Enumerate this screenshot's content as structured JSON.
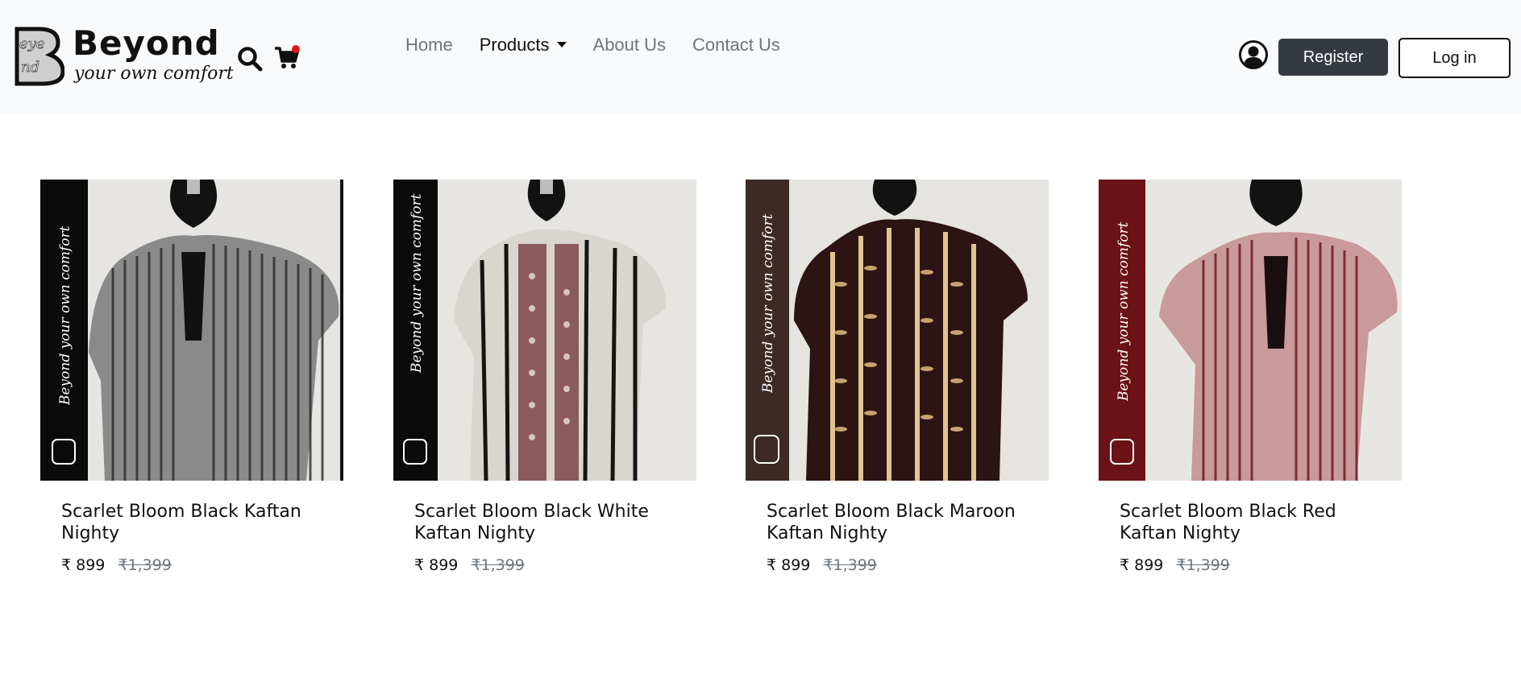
{
  "brand": {
    "mark_text": "Beyond",
    "name": "Beyond",
    "tagline": "your own comfort"
  },
  "header": {
    "search_icon": "search-icon",
    "cart_icon": "cart-icon",
    "user_icon": "user-circle-icon",
    "cart_badge_color": "#e21818",
    "nav": [
      {
        "label": "Home"
      },
      {
        "label": "Products"
      },
      {
        "label": "About Us"
      },
      {
        "label": "Contact Us"
      }
    ],
    "register_label": "Register",
    "login_label": "Log in"
  },
  "products": [
    {
      "name": "Scarlet Bloom Black Kaftan Nighty",
      "price": "₹ 899",
      "mrp": "₹1,399",
      "band_color": "#0b0b0b",
      "watermark": "Beyond your own comfort"
    },
    {
      "name": "Scarlet Bloom Black White Kaftan Nighty",
      "price": "₹ 899",
      "mrp": "₹1,399",
      "band_color": "#0b0b0b",
      "watermark": "Beyond your own comfort"
    },
    {
      "name": "Scarlet Bloom Black Maroon Kaftan Nighty",
      "price": "₹ 899",
      "mrp": "₹1,399",
      "band_color": "#3d2a27",
      "watermark": "Beyond your own comfort"
    },
    {
      "name": "Scarlet Bloom Black Red Kaftan Nighty",
      "price": "₹ 899",
      "mrp": "₹1,399",
      "band_color": "#6b1216",
      "watermark": "Beyond your own comfort"
    }
  ]
}
